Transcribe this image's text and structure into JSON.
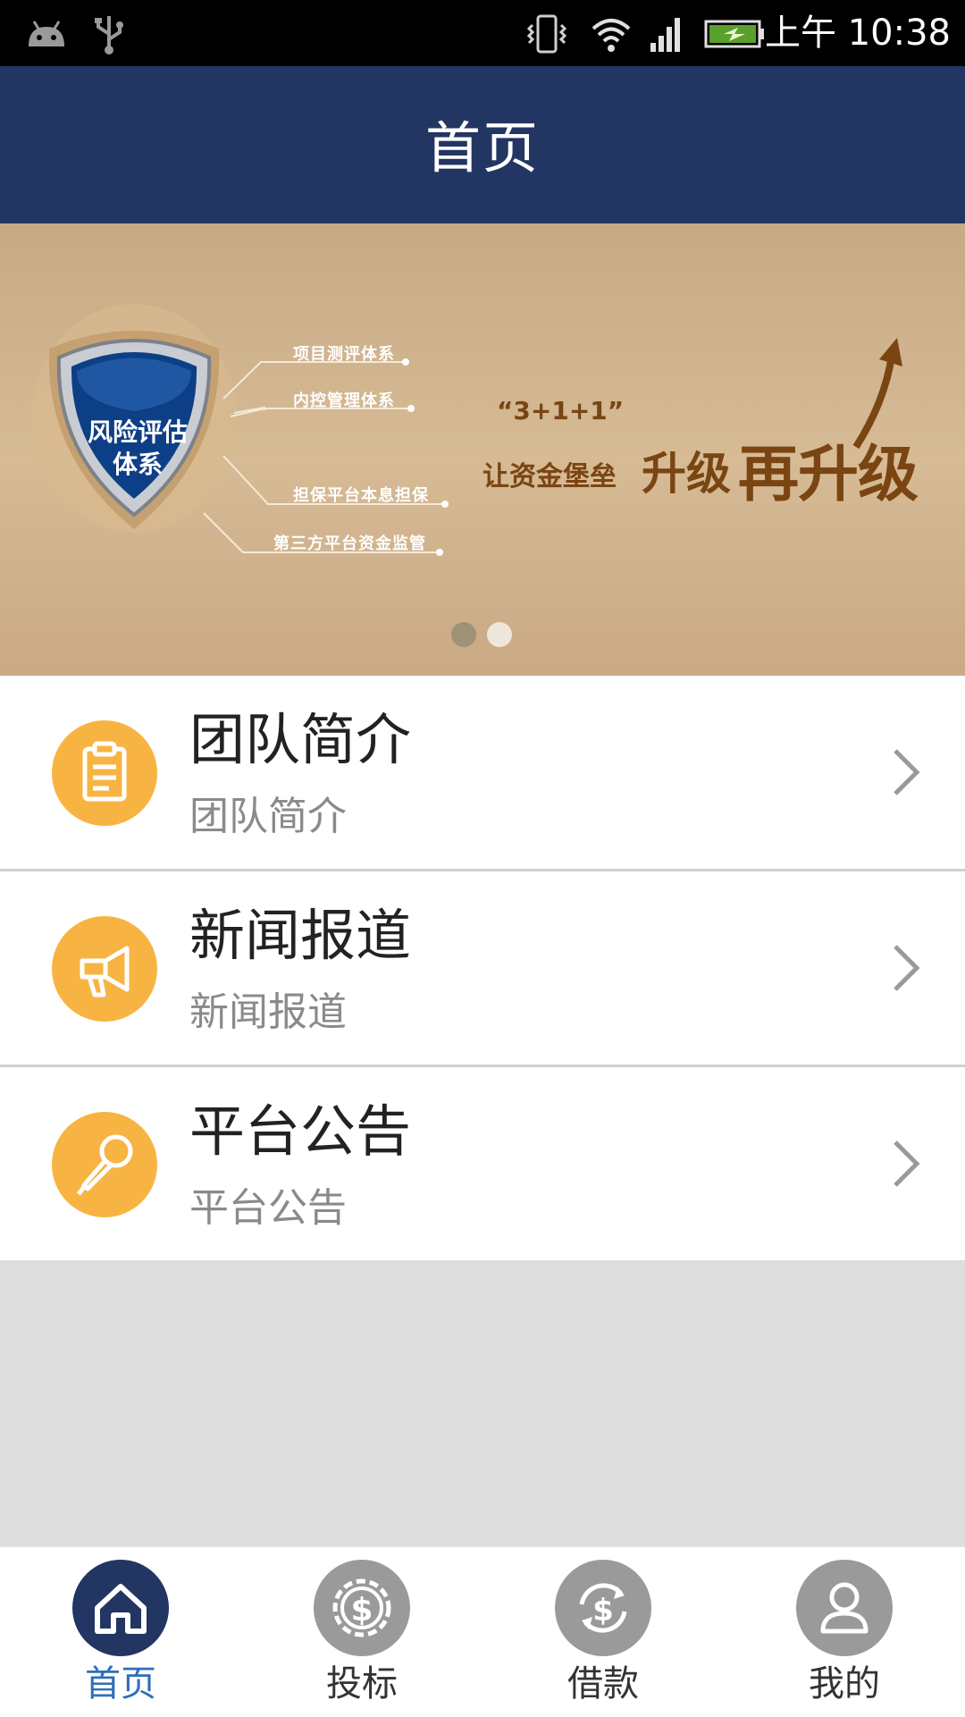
{
  "status_bar": {
    "time": "上午 10:38",
    "icons": [
      "android-icon",
      "usb-icon",
      "vibrate-icon",
      "wifi-icon",
      "signal-icon",
      "battery-icon"
    ]
  },
  "header": {
    "title": "首页"
  },
  "banner": {
    "shield_text": "风险评估\n体系",
    "tags": [
      "项目测评体系",
      "内控管理体系",
      "担保平台本息担保",
      "第三方平台资金监管"
    ],
    "formula": "“3+1+1”",
    "slogan_small": "让资金堡垒",
    "slogan_big1": "升级",
    "slogan_big2": "再升级",
    "active_slide": 1,
    "slide_count": 2
  },
  "list": {
    "items": [
      {
        "title": "团队简介",
        "subtitle": "团队简介",
        "icon": "clipboard-icon"
      },
      {
        "title": "新闻报道",
        "subtitle": "新闻报道",
        "icon": "megaphone-icon"
      },
      {
        "title": "平台公告",
        "subtitle": "平台公告",
        "icon": "microphone-icon"
      }
    ]
  },
  "bottom_nav": {
    "items": [
      {
        "label": "首页",
        "icon": "home-icon",
        "active": true
      },
      {
        "label": "投标",
        "icon": "dollar-gear-icon",
        "active": false
      },
      {
        "label": "借款",
        "icon": "dollar-refresh-icon",
        "active": false
      },
      {
        "label": "我的",
        "icon": "user-icon",
        "active": false
      }
    ]
  },
  "colors": {
    "header_bg": "#233562",
    "accent_orange": "#f8b442",
    "nav_active": "#233562",
    "nav_active_text": "#2e6fb6",
    "nav_inactive": "#9a9a9a",
    "banner_text": "#7a4512"
  }
}
